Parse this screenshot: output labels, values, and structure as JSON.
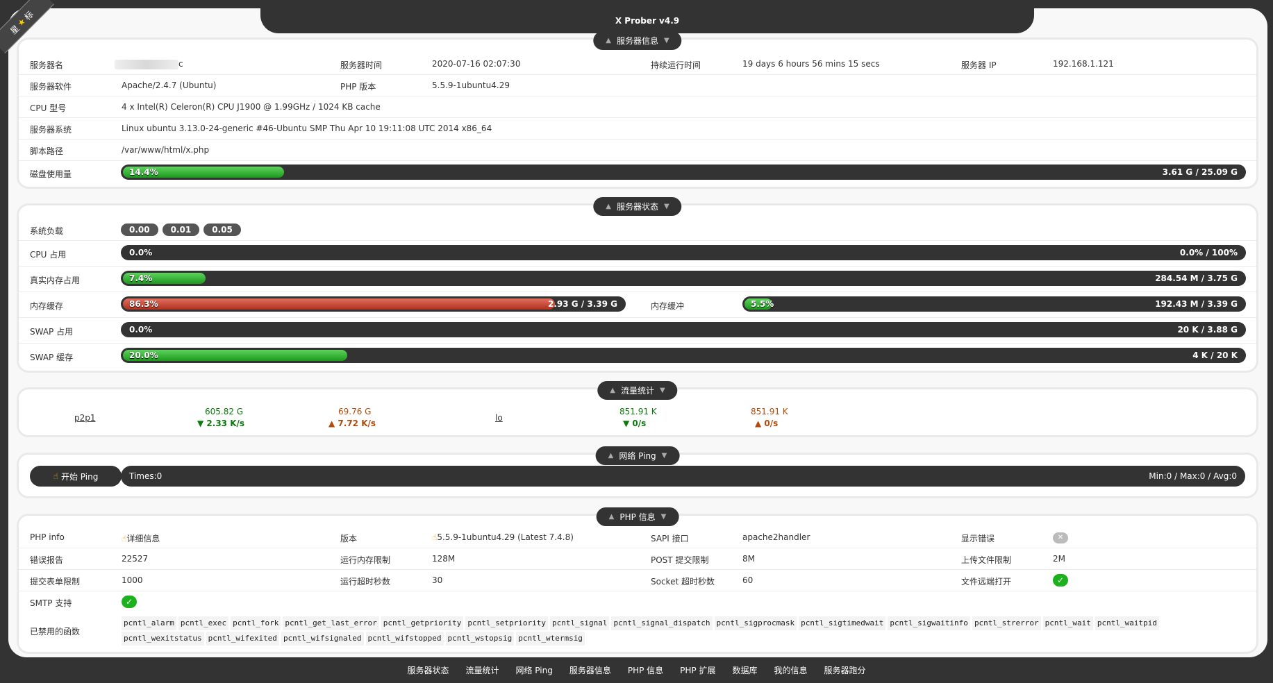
{
  "app": {
    "title": "X Prober v4.9",
    "ribbon": [
      "星",
      "★",
      "标"
    ]
  },
  "server_info": {
    "title": "服务器信息",
    "name_label": "服务器名",
    "name_value_suffix": "c",
    "time_label": "服务器时间",
    "time_value": "2020-07-16 02:07:30",
    "uptime_label": "持续运行时间",
    "uptime_value": "19 days 6 hours 56 mins 15 secs",
    "ip_label": "服务器 IP",
    "ip_value": "192.168.1.121",
    "software_label": "服务器软件",
    "software_value": "Apache/2.4.7 (Ubuntu)",
    "php_label": "PHP 版本",
    "php_value": "5.5.9-1ubuntu4.29",
    "cpu_label": "CPU 型号",
    "cpu_value": "4 x Intel(R) Celeron(R) CPU J1900 @ 1.99GHz / 1024 KB cache",
    "os_label": "服务器系统",
    "os_value": "Linux ubuntu 3.13.0-24-generic #46-Ubuntu SMP Thu Apr 10 19:11:08 UTC 2014 x86_64",
    "path_label": "脚本路径",
    "path_value": "/var/www/html/x.php",
    "disk_label": "磁盘使用量",
    "disk_pct": "14.4%",
    "disk_value": "3.61 G / 25.09 G",
    "disk_fraction": 0.144
  },
  "server_status": {
    "title": "服务器状态",
    "load_label": "系统负载",
    "load": [
      "0.00",
      "0.01",
      "0.05"
    ],
    "cpu_label": "CPU 占用",
    "cpu_pct": "0.0%",
    "cpu_value": "0.0% / 100%",
    "cpu_fraction": 0.0,
    "mem_label": "真实内存占用",
    "mem_pct": "7.4%",
    "mem_value": "284.54 M / 3.75 G",
    "mem_fraction": 0.074,
    "cache_label": "内存缓存",
    "cache_pct": "86.3%",
    "cache_value": "2.93 G / 3.39 G",
    "cache_fraction": 0.863,
    "buffer_label": "内存缓冲",
    "buffer_pct": "5.5%",
    "buffer_value": "192.43 M / 3.39 G",
    "buffer_fraction": 0.055,
    "swap_label": "SWAP 占用",
    "swap_pct": "0.0%",
    "swap_value": "20 K / 3.88 G",
    "swap_fraction": 0.0,
    "swapcache_label": "SWAP 缓存",
    "swapcache_pct": "20.0%",
    "swapcache_value": "4 K / 20 K",
    "swapcache_fraction": 0.2
  },
  "network": {
    "title": "流量统计",
    "interfaces": [
      {
        "name": "p2p1",
        "rx_total": "605.82 G",
        "rx_rate": "▼ 2.33 K/s",
        "tx_total": "69.76 G",
        "tx_rate": "▲ 7.72 K/s"
      },
      {
        "name": "lo",
        "rx_total": "851.91 K",
        "rx_rate": "▼ 0/s",
        "tx_total": "851.91 K",
        "tx_rate": "▲ 0/s"
      }
    ]
  },
  "ping": {
    "title": "网络 Ping",
    "button": "开始 Ping",
    "times": "Times:0",
    "stats": "Min:0 / Max:0 / Avg:0"
  },
  "php_info": {
    "title": "PHP 信息",
    "phpinfo_label": "PHP info",
    "phpinfo_value": "详细信息",
    "version_label": "版本",
    "version_value": "5.5.9-1ubuntu4.29 (Latest 7.4.8)",
    "sapi_label": "SAPI 接口",
    "sapi_value": "apache2handler",
    "display_errors_label": "显示错误",
    "display_errors": false,
    "error_report_label": "错误报告",
    "error_report_value": "22527",
    "memory_limit_label": "运行内存限制",
    "memory_limit_value": "128M",
    "post_max_label": "POST 提交限制",
    "post_max_value": "8M",
    "upload_max_label": "上传文件限制",
    "upload_max_value": "2M",
    "max_input_label": "提交表单限制",
    "max_input_value": "1000",
    "max_exec_label": "运行超时秒数",
    "max_exec_value": "30",
    "socket_timeout_label": "Socket 超时秒数",
    "socket_timeout_value": "60",
    "url_fopen_label": "文件远端打开",
    "url_fopen": true,
    "smtp_label": "SMTP 支持",
    "smtp": true,
    "disabled_label": "已禁用的函数",
    "disabled_functions": [
      "pcntl_alarm",
      "pcntl_exec",
      "pcntl_fork",
      "pcntl_get_last_error",
      "pcntl_getpriority",
      "pcntl_setpriority",
      "pcntl_signal",
      "pcntl_signal_dispatch",
      "pcntl_sigprocmask",
      "pcntl_sigtimedwait",
      "pcntl_sigwaitinfo",
      "pcntl_strerror",
      "pcntl_wait",
      "pcntl_waitpid",
      "pcntl_wexitstatus",
      "pcntl_wifexited",
      "pcntl_wifsignaled",
      "pcntl_wifstopped",
      "pcntl_wstopsig",
      "pcntl_wtermsig"
    ]
  },
  "bottom_nav": [
    "服务器状态",
    "流量统计",
    "网络 Ping",
    "服务器信息",
    "PHP 信息",
    "PHP 扩展",
    "数据库",
    "我的信息",
    "服务器跑分"
  ],
  "colors": {
    "bar_bg": "#333333",
    "green": "#1c9a1c",
    "red": "#b0301e"
  }
}
